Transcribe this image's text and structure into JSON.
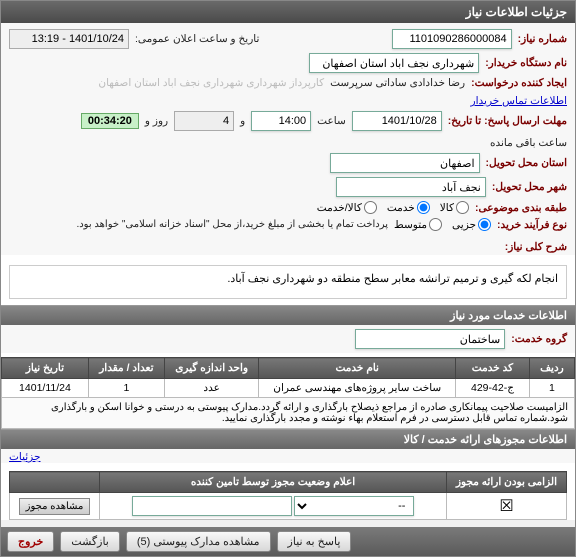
{
  "titlebar": "جزئیات اطلاعات نیاز",
  "labels": {
    "need_no": "شماره نیاز:",
    "announce_datetime": "تاریخ و ساعت اعلان عمومی:",
    "buyer_org": "نام دستگاه خریدار:",
    "creator": "ایجاد کننده درخواست:",
    "creator_role": "کارپرداز شهرداری شهرداری نجف اباد استان اصفهان",
    "buyer_contact": "اطلاعات تماس خریدار",
    "deadline": "مهلت ارسال پاسخ: تا تاریخ:",
    "time_word": "ساعت",
    "and_word": "و",
    "day_word": "روز و",
    "remaining": "ساعت باقی مانده",
    "delivery_province": "استان محل تحویل:",
    "delivery_city": "شهر محل تحویل:",
    "category": "طبقه بندی موضوعی:",
    "purchase_type": "نوع فرآیند خرید:",
    "purchase_note": "پرداخت تمام یا بخشی از مبلغ خرید،از محل \"اسناد خزانه اسلامی\" خواهد بود.",
    "general_desc": "شرح کلی نیاز:",
    "section_items": "اطلاعات خدمات مورد نیاز",
    "service_group": "گروه خدمت:",
    "section_auth": "اطلاعات مجوزهای ارائه خدمت / کالا",
    "details": "جزئیات"
  },
  "values": {
    "need_no": "1101090286000084",
    "announce_datetime": "1401/10/24 - 13:19",
    "buyer_org": "شهرداری نجف اباد استان اصفهان",
    "creator": "رضا خدادادی ساداتی سرپرست",
    "deadline_date": "1401/10/28",
    "deadline_time": "14:00",
    "remaining_days": "4",
    "remaining_time": "00:34:20",
    "province": "اصفهان",
    "city": "نجف آباد",
    "service_group": "ساختمان",
    "general_desc": "انجام لکه گیری و ترمیم ترانشه معابر سطح منطقه دو شهرداری نجف آباد."
  },
  "radios": {
    "cat": {
      "goods": "کالا",
      "service": "خدمت",
      "both": "کالا/خدمت",
      "selected": "service"
    },
    "ptype": {
      "partial": "جزیی",
      "medium": "متوسط",
      "selected": "partial"
    }
  },
  "table": {
    "headers": [
      "ردیف",
      "کد خدمت",
      "نام خدمت",
      "واحد اندازه گیری",
      "تعداد / مقدار",
      "تاریخ نیاز"
    ],
    "rows": [
      {
        "idx": "1",
        "code": "ج-42-429",
        "name": "ساخت سایر پروژه‌های مهندسی عمران",
        "unit": "عدد",
        "qty": "1",
        "date": "1401/11/24"
      }
    ],
    "note": "الزامیست صلاحیت پیمانکاری صادره از مراجع ذیصلاح بارگذاری و ارائه گردد.مدارک پیوستی به درستی و خوانا اسکن و بارگذاری شود.شماره تماس قابل دسترسی در فرم استعلام بهاء نوشته و مجدد بارگذاری نمایید."
  },
  "auth_table": {
    "headers": [
      "الزامی بودن ارائه مجوز",
      "اعلام وضعیت مجوز توسط تامین کننده",
      ""
    ],
    "view_label": "مشاهده مجوز",
    "placeholder": "--"
  },
  "footer": {
    "exit": "خروج",
    "back": "بازگشت",
    "attachments": "مشاهده مدارک پیوستی (5)",
    "respond": "پاسخ به نیاز"
  }
}
